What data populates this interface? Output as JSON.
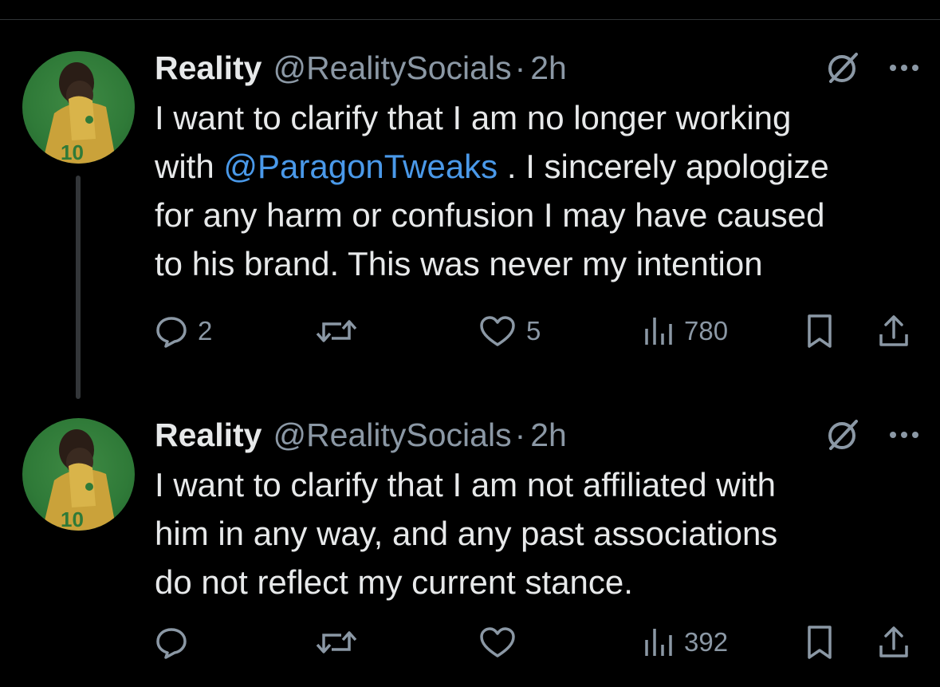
{
  "tweets": [
    {
      "name": "Reality",
      "handle": "@RealitySocials",
      "separator": "·",
      "time": "2h",
      "text_line1": "I want to clarify that I am no longer working",
      "text_line2_start": "with ",
      "mention": "@ParagonTweaks",
      "text_line2_end": " . I sincerely apologize",
      "text_line3": "for any harm or confusion I may have caused",
      "text_line4": "to his brand. This was never my intention",
      "replies": "2",
      "reposts": "",
      "likes": "5",
      "views": "780"
    },
    {
      "name": "Reality",
      "handle": "@RealitySocials",
      "separator": "·",
      "time": "2h",
      "text_line1": "I want to clarify that I am not affiliated with",
      "text_line2": "him in any way, and any past associations",
      "text_line3": "do not reflect my current stance.",
      "replies": "",
      "reposts": "",
      "likes": "",
      "views": "392"
    }
  ],
  "colors": {
    "background": "#000000",
    "text": "#e7e9ea",
    "secondary": "#8b98a5",
    "mention": "#4a99e9",
    "thread_line": "#333639"
  },
  "icons": [
    "grok-icon",
    "more-icon",
    "reply-icon",
    "repost-icon",
    "like-icon",
    "views-icon",
    "bookmark-icon",
    "share-icon"
  ]
}
